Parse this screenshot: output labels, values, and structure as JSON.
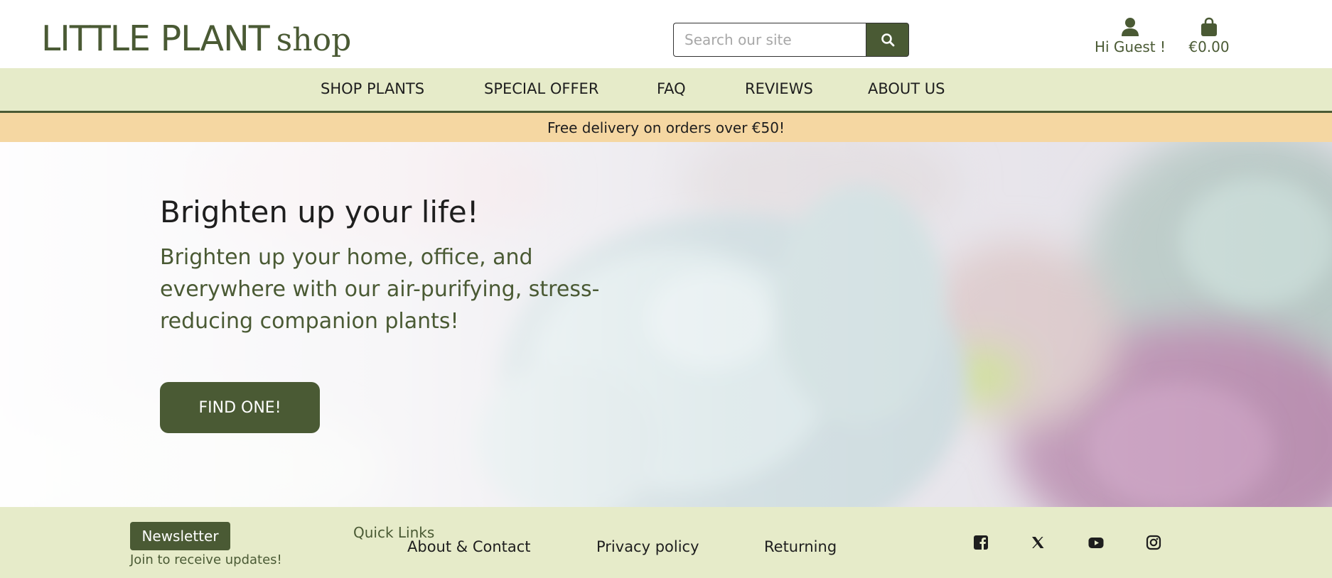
{
  "header": {
    "logo_main": "LITTLE PLANT",
    "logo_sub": "shop",
    "search_placeholder": "Search our site",
    "search_icon": "search-icon",
    "account_label": "Hi Guest !",
    "account_icon": "user-icon",
    "bag_total": "€0.00",
    "bag_icon": "shopping-bag-icon"
  },
  "nav": {
    "items": [
      "SHOP PLANTS",
      "SPECIAL OFFER",
      "FAQ",
      "REVIEWS",
      "ABOUT US"
    ]
  },
  "banner": {
    "text": "Free delivery on orders over €50!"
  },
  "hero": {
    "title": "Brighten up your life!",
    "text": "Brighten up your home, office, and everywhere with our air-purifying, stress-reducing companion plants!",
    "button": "FIND ONE!"
  },
  "footer": {
    "newsletter_button": "Newsletter",
    "newsletter_note": "Join to receive updates!",
    "quick_links_heading": "Quick Links",
    "links": [
      "About & Contact",
      "Privacy policy",
      "Returning"
    ],
    "social_icons": [
      "facebook-icon",
      "x-twitter-icon",
      "youtube-icon",
      "instagram-icon"
    ]
  },
  "colors": {
    "brand_green": "#4a5a34",
    "nav_background": "#e6ebc9",
    "banner_background": "#f5d7a2"
  }
}
